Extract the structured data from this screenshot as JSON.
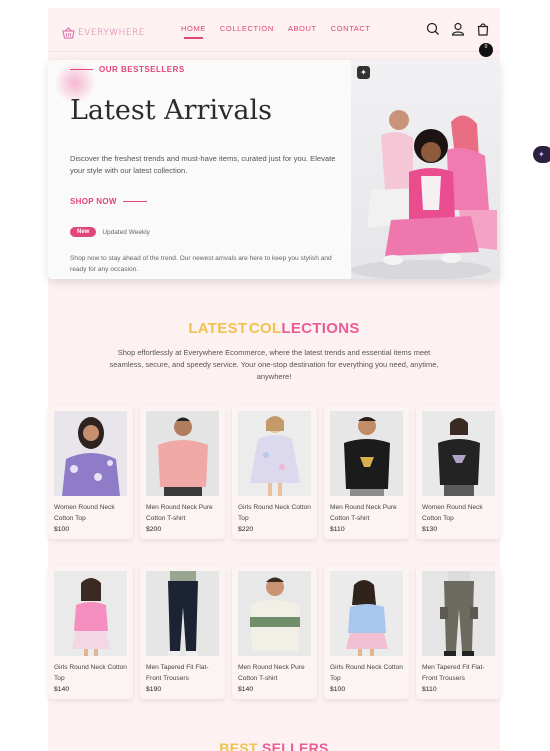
{
  "brand": {
    "name": "EVERYWHERE",
    "accent": "#e0457b"
  },
  "nav": {
    "links": [
      "HOME",
      "COLLECTION",
      "ABOUT",
      "CONTACT"
    ],
    "active": "HOME",
    "icons": [
      "search-icon",
      "user-icon",
      "cart-icon"
    ],
    "cart_count": "0"
  },
  "hero": {
    "eyebrow": "OUR BESTSELLERS",
    "title": "Latest Arrivals",
    "description": "Discover the freshest trends and must-have items, curated just for you. Elevate your style with our latest collection.",
    "cta": "SHOP NOW",
    "badge": "New",
    "badge_text": "Updated Weekly",
    "note": "Shop now to stay ahead of the trend. Our newest arrivals are here to keep you stylish and ready for any occasion."
  },
  "collections": {
    "title_part1": "LATEST",
    "title_part2a": "COL",
    "title_part2b": "LECTIONS",
    "description": "Shop effortlessly at Everywhere Ecommerce, where the latest trends and essential items meet seamless, secure, and speedy service. Your one-stop destination for everything you need, anytime, anywhere!",
    "products": [
      {
        "name": "Women Round Neck Cotton Top",
        "price": "$100",
        "bg": "#e8e6ea"
      },
      {
        "name": "Men Round Neck Pure Cotton T-shirt",
        "price": "$200",
        "bg": "#e4e4e4"
      },
      {
        "name": "Girls Round Neck Cotton Top",
        "price": "$220",
        "bg": "#ececec"
      },
      {
        "name": "Men Round Neck Pure Cotton T-shirt",
        "price": "$110",
        "bg": "#e7e7e7"
      },
      {
        "name": "Women Round Neck Cotton Top",
        "price": "$130",
        "bg": "#e9e9e9"
      },
      {
        "name": "Girls Round Neck Cotton Top",
        "price": "$140",
        "bg": "#eaeaea"
      },
      {
        "name": "Men Tapered Fit Flat-Front Trousers",
        "price": "$190",
        "bg": "#e6e6e6"
      },
      {
        "name": "Men Round Neck Pure Cotton T-shirt",
        "price": "$140",
        "bg": "#e8e8e8"
      },
      {
        "name": "Girls Round Neck Cotton Top",
        "price": "$100",
        "bg": "#ebebeb"
      },
      {
        "name": "Men Tapered Fit Flat-Front Trousers",
        "price": "$110",
        "bg": "#e5e5e5"
      }
    ]
  },
  "bestsellers": {
    "title_part1": "BEST",
    "title_part2": "SELLERS"
  }
}
